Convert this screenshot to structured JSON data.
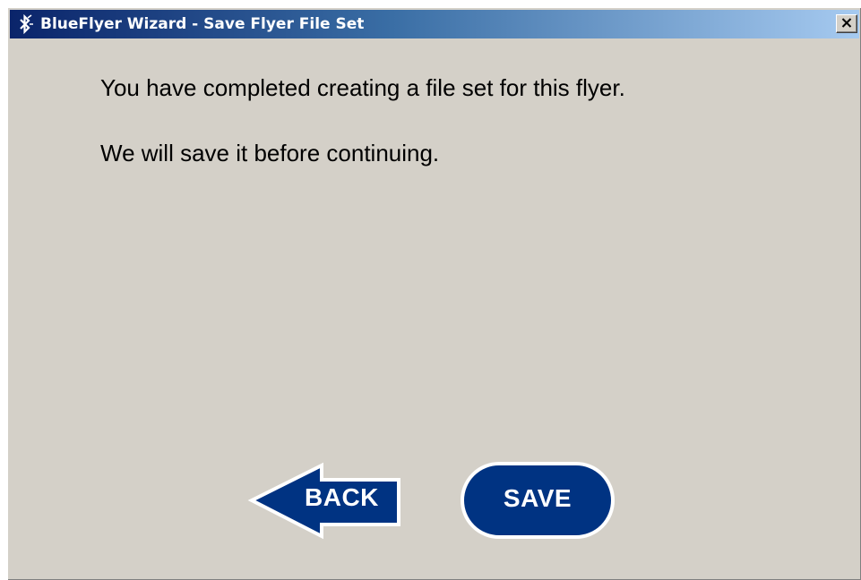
{
  "window": {
    "title": "BlueFlyer Wizard - Save Flyer File Set",
    "icon": "bluetooth-icon",
    "close_icon": "close-icon"
  },
  "content": {
    "message_line1": "You have completed creating a file set for this flyer.",
    "message_line2": "We will save it before continuing."
  },
  "buttons": {
    "back_label": "BACK",
    "save_label": "SAVE"
  },
  "colors": {
    "button_fill": "#003382",
    "button_text": "#ffffff",
    "window_bg": "#d4d0c8",
    "title_gradient_start": "#0a246a",
    "title_gradient_end": "#a6caf0"
  }
}
